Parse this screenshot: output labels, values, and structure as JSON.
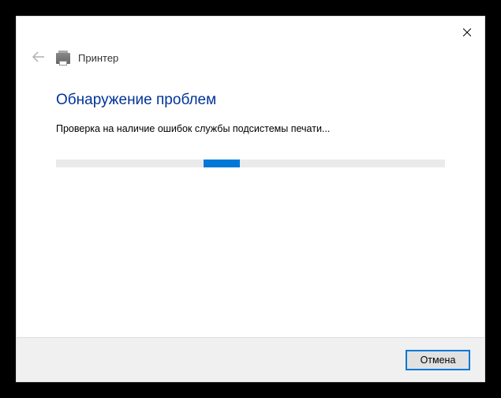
{
  "header": {
    "title": "Принтер"
  },
  "content": {
    "heading": "Обнаружение проблем",
    "status": "Проверка на наличие ошибок службы подсистемы печати..."
  },
  "footer": {
    "cancel_label": "Отмена"
  }
}
